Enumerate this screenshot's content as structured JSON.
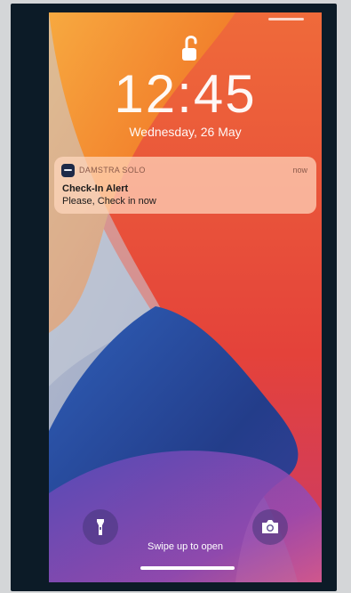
{
  "lockscreen": {
    "time": "12:45",
    "date": "Wednesday, 26 May",
    "swipe_hint": "Swipe up to open",
    "icons": {
      "lock": "unlocked-padlock-icon",
      "flashlight": "flashlight-icon",
      "camera": "camera-icon"
    }
  },
  "notification": {
    "app": "DAMSTRA SOLO",
    "time": "now",
    "title": "Check-In Alert",
    "body": "Please, Check in now",
    "app_icon": "damstra-app-icon"
  },
  "colors": {
    "orange": "#f08a2a",
    "red": "#e84a3a",
    "blue": "#243f8c",
    "purple": "#7a4aa8",
    "device_frame": "#0c1b27"
  }
}
